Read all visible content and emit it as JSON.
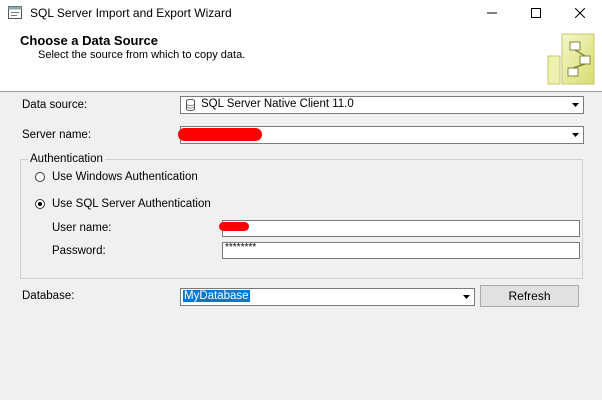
{
  "window": {
    "title": "SQL Server Import and Export Wizard"
  },
  "header": {
    "title": "Choose a Data Source",
    "subtitle": "Select the source from which to copy data."
  },
  "form": {
    "data_source_label": "Data source:",
    "data_source_value": "SQL Server Native Client 11.0",
    "server_name_label": "Server name:",
    "server_name_value": "",
    "auth_legend": "Authentication",
    "windows_auth_label": "Use Windows Authentication",
    "sql_auth_label": "Use SQL Server Authentication",
    "username_label": "User name:",
    "username_value": "",
    "password_label": "Password:",
    "password_value": "********",
    "database_label": "Database:",
    "database_value": "MyDatabase",
    "refresh_label": "Refresh",
    "selected_auth": "sql"
  }
}
